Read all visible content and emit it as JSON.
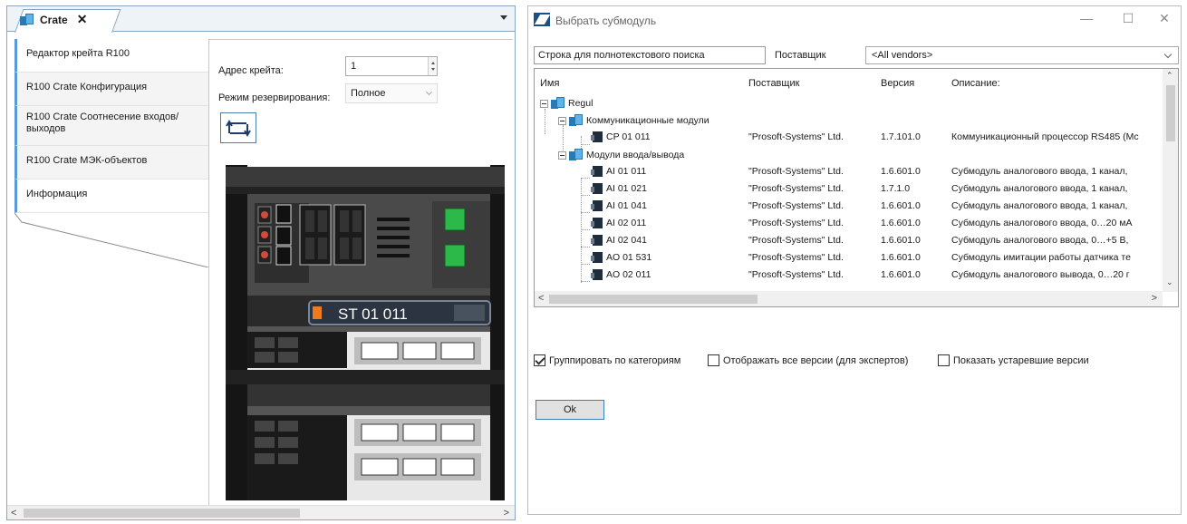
{
  "editor": {
    "tab_title": "Crate",
    "tab_close": "✕",
    "nav": [
      {
        "label": "Редактор крейта R100"
      },
      {
        "label": "R100 Crate Конфигурация"
      },
      {
        "label": "R100 Crate Соотнесение входов/выходов"
      },
      {
        "label": "R100 Crate МЭК-объектов"
      },
      {
        "label": "Информация"
      }
    ],
    "address_label": "Адрес крейта:",
    "address_value": "1",
    "redundancy_label": "Режим резервирования:",
    "redundancy_value": "Полное",
    "module_label": "ST 01 011"
  },
  "dialog": {
    "title": "Выбрать субмодуль",
    "search_value": "Строка для полнотекстового поиска",
    "vendor_label": "Поставщик",
    "vendor_value": "<All vendors>",
    "columns": [
      "Имя",
      "Поставщик",
      "Версия",
      "Описание:"
    ],
    "tree": {
      "root": "Regul",
      "groups": [
        {
          "name": "Коммуникационные модули",
          "items": [
            {
              "name": "CP 01 011",
              "vendor": "\"Prosoft-Systems\" Ltd.",
              "version": "1.7.101.0",
              "desc": "Коммуникационный процессор RS485 (Мс"
            }
          ]
        },
        {
          "name": "Модули ввода/вывода",
          "items": [
            {
              "name": "AI 01 011",
              "vendor": "\"Prosoft-Systems\" Ltd.",
              "version": "1.6.601.0",
              "desc": "Субмодуль аналогового ввода, 1 канал,"
            },
            {
              "name": "AI 01 021",
              "vendor": "\"Prosoft-Systems\" Ltd.",
              "version": "1.7.1.0",
              "desc": "Субмодуль аналогового ввода, 1 канал,"
            },
            {
              "name": "AI 01 041",
              "vendor": "\"Prosoft-Systems\" Ltd.",
              "version": "1.6.601.0",
              "desc": "Субмодуль аналогового ввода, 1 канал,"
            },
            {
              "name": "AI 02 011",
              "vendor": "\"Prosoft-Systems\" Ltd.",
              "version": "1.6.601.0",
              "desc": "Субмодуль аналогового ввода, 0…20 мА"
            },
            {
              "name": "AI 02 041",
              "vendor": "\"Prosoft-Systems\" Ltd.",
              "version": "1.6.601.0",
              "desc": "Субмодуль аналогового ввода, 0…+5 В,"
            },
            {
              "name": "AO 01 531",
              "vendor": "\"Prosoft-Systems\" Ltd.",
              "version": "1.6.601.0",
              "desc": "Субмодуль имитации работы датчика те"
            },
            {
              "name": "AO 02 011",
              "vendor": "\"Prosoft-Systems\" Ltd.",
              "version": "1.6.601.0",
              "desc": "Субмодуль аналогового вывода, 0…20 г"
            }
          ]
        }
      ]
    },
    "options": [
      {
        "label": "Группировать по категориям",
        "checked": true
      },
      {
        "label": "Отображать все версии (для экспертов)",
        "checked": false
      },
      {
        "label": "Показать устаревшие версии",
        "checked": false
      }
    ],
    "ok_label": "Ok"
  }
}
